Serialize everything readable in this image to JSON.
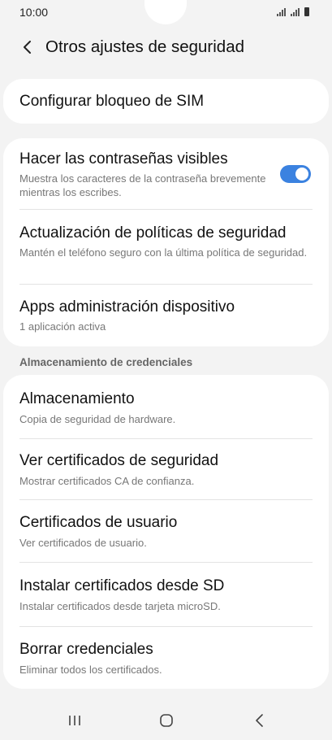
{
  "status_bar": {
    "time": "10:00"
  },
  "header": {
    "title": "Otros ajustes de seguridad"
  },
  "sim_card": {
    "title": "Configurar bloqueo de SIM"
  },
  "security_card": {
    "items": [
      {
        "title": "Hacer las contraseñas visibles",
        "subtitle": "Muestra los caracteres de la contraseña brevemente mientras los escribes.",
        "toggle_on": true
      },
      {
        "title": "Actualización de políticas de seguridad",
        "subtitle": "Mantén el teléfono seguro con la última política de seguridad."
      },
      {
        "title": "Apps administración dispositivo",
        "subtitle": "1 aplicación activa"
      }
    ]
  },
  "credentials_section": {
    "label": "Almacenamiento de credenciales"
  },
  "credentials_card": {
    "items": [
      {
        "title": "Almacenamiento",
        "subtitle": "Copia de seguridad de hardware."
      },
      {
        "title": "Ver certificados de seguridad",
        "subtitle": "Mostrar certificados CA de confianza."
      },
      {
        "title": "Certificados de usuario",
        "subtitle": "Ver certificados de usuario."
      },
      {
        "title": "Instalar certificados desde SD",
        "subtitle": "Instalar certificados desde tarjeta microSD."
      },
      {
        "title": "Borrar credenciales",
        "subtitle": "Eliminar todos los certificados."
      }
    ]
  },
  "colors": {
    "accent": "#3b82e0",
    "background": "#f3f3f3",
    "card": "#ffffff"
  },
  "icons": {
    "back": "chevron-left-icon",
    "recents": "recents-icon",
    "home": "home-icon",
    "nav_back": "nav-back-icon"
  }
}
